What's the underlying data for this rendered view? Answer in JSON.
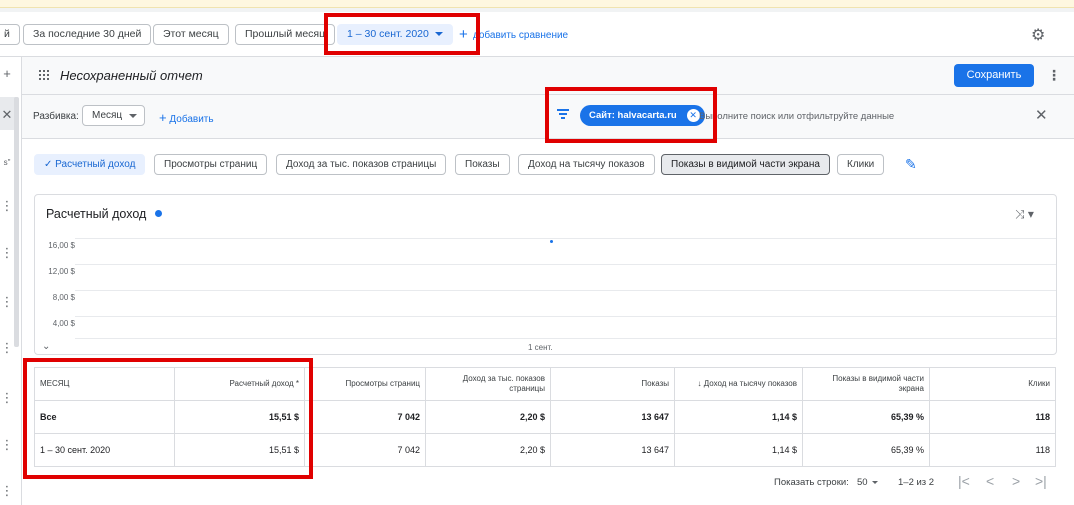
{
  "date_bar": {
    "chips": [
      "й",
      "За последние 30 дней",
      "Этот месяц",
      "Прошлый месяц"
    ],
    "selected_range": "1 – 30 сент. 2020",
    "add_comparison": "добавить сравнение"
  },
  "left_rail": {
    "items": [
      "+",
      "✕",
      "s\"",
      "⋮",
      "⋮",
      "⋮",
      "⋮",
      "⋮",
      "⋮",
      "⋮"
    ]
  },
  "header": {
    "title": "Несохраненный отчет",
    "save_label": "Сохранить"
  },
  "filter_bar": {
    "breakdown_label": "Разбивка:",
    "breakdown_value": "Месяц",
    "add_label": "Добавить",
    "site_filter": "Сайт: halvacarta.ru",
    "search_placeholder": "Выполните поиск или отфильтруйте данные"
  },
  "metrics": [
    {
      "label": "Расчетный доход",
      "state": "on"
    },
    {
      "label": "Просмотры страниц",
      "state": "off"
    },
    {
      "label": "Доход за тыс. показов страницы",
      "state": "off"
    },
    {
      "label": "Показы",
      "state": "off"
    },
    {
      "label": "Доход на тысячу показов",
      "state": "off"
    },
    {
      "label": "Показы в видимой части экрана",
      "state": "dark"
    },
    {
      "label": "Клики",
      "state": "off"
    }
  ],
  "chart_data": {
    "type": "line",
    "title": "Расчетный доход",
    "y_ticks": [
      "16,00 $",
      "12,00 $",
      "8,00 $",
      "4,00 $"
    ],
    "x_ticks": [
      "1 сент."
    ],
    "series": [
      {
        "name": "Расчетный доход",
        "x": [
          "1 сент."
        ],
        "values": [
          15.51
        ]
      }
    ],
    "color": "#1a73e8"
  },
  "table": {
    "headers": [
      "МЕСЯЦ",
      "Расчетный доход *",
      "Просмотры страниц",
      "Доход за тыс. показов страницы",
      "Показы",
      "↓ Доход на тысячу показов",
      "Показы в видимой части экрана",
      "Клики"
    ],
    "rows": [
      [
        "Все",
        "15,51 $",
        "7 042",
        "2,20 $",
        "13 647",
        "1,14 $",
        "65,39 %",
        "118"
      ],
      [
        "1 – 30 сент. 2020",
        "15,51 $",
        "7 042",
        "2,20 $",
        "13 647",
        "1,14 $",
        "65,39 %",
        "118"
      ]
    ]
  },
  "pagination": {
    "rows_label": "Показать строки:",
    "rows_value": "50",
    "range": "1–2 из 2"
  },
  "colors": {
    "accent": "#1a73e8",
    "highlight": "#e00000"
  }
}
